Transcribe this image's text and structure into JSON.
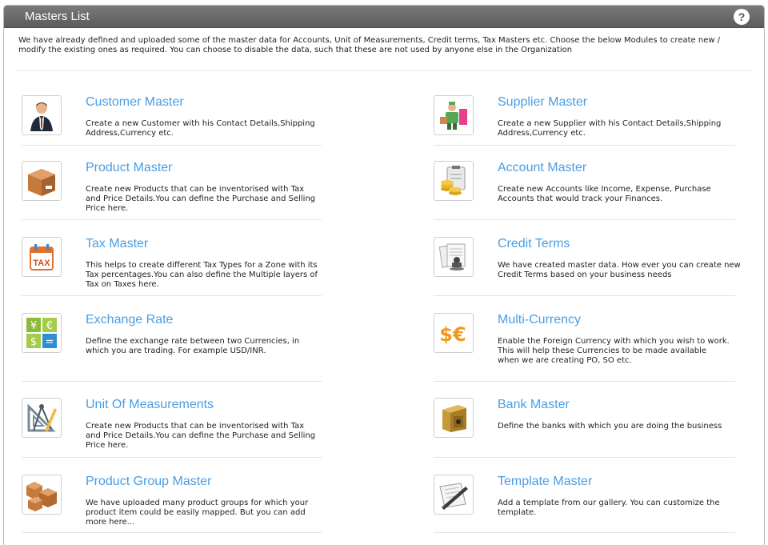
{
  "window": {
    "title": "Masters List",
    "help_label": "?"
  },
  "intro": "We have already defined and uploaded some of the master data for Accounts, Unit of Measurements, Credit terms, Tax Masters etc. Choose the below Modules to create new / modify the existing ones as required. You can choose to disable the data, such that these are not used by anyone else in the Organization",
  "left": [
    {
      "name": "Customer Master",
      "icon": "customer-icon",
      "desc": [
        "Create a new Customer with his Contact Details,Shipping",
        "Address,Currency etc."
      ]
    },
    {
      "name": "Product Master",
      "icon": "box-icon",
      "desc": [
        "Create new Products that can be inventorised with Tax",
        "and Price Details.You can define the Purchase and Selling",
        "Price here."
      ]
    },
    {
      "name": "Tax Master",
      "icon": "tax-calendar-icon",
      "desc": [
        "This helps to create different Tax Types for a Zone with its",
        "Tax percentages.You can also define the Multiple layers of",
        "Tax on Taxes here."
      ]
    },
    {
      "name": "Exchange Rate",
      "icon": "currency-exchange-icon",
      "desc": [
        "Define the exchange rate between two Currencies, in",
        "which you are trading. For example USD/INR."
      ]
    },
    {
      "name": "Unit Of Measurements",
      "icon": "drafting-tools-icon",
      "desc": [
        "Create new Products that can be inventorised with Tax",
        "and Price Details.You can define the Purchase and Selling",
        "Price here."
      ]
    },
    {
      "name": "Product Group Master",
      "icon": "boxes-icon",
      "desc": [
        "We have uploaded many product groups for which your",
        "product item could be easily mapped. But you can add",
        "more here..."
      ]
    }
  ],
  "right": [
    {
      "name": "Supplier Master",
      "icon": "supplier-icon",
      "desc": [
        "Create a new Supplier with his Contact Details,Shipping",
        "Address,Currency etc."
      ]
    },
    {
      "name": "Account Master",
      "icon": "coins-clipboard-icon",
      "desc": [
        "Create new Accounts like Income, Expense, Purchase",
        "Accounts that would track your Finances."
      ]
    },
    {
      "name": "Credit Terms",
      "icon": "documents-stamp-icon",
      "desc": [
        "We have created master data. How ever you can create new",
        "Credit Terms based on your business needs"
      ]
    },
    {
      "name": "Multi-Currency",
      "icon": "dollar-euro-icon",
      "desc": [
        "Enable the Foreign Currency with which you wish to work.",
        "This will help these Currencies to be made available",
        "when we are creating PO, SO etc."
      ]
    },
    {
      "name": "Bank Master",
      "icon": "safe-icon",
      "desc": [
        "Define the banks with which you are doing the business"
      ]
    },
    {
      "name": "Template Master",
      "icon": "document-pen-icon",
      "desc": [
        "Add a template from our gallery. You can customize the",
        "template."
      ]
    }
  ],
  "icon_glyphs": {
    "tax": "TAX",
    "exchange_tl": "¥",
    "exchange_tr": "€",
    "exchange_bl": "$",
    "exchange_br": "=",
    "multi_currency": "$€"
  }
}
